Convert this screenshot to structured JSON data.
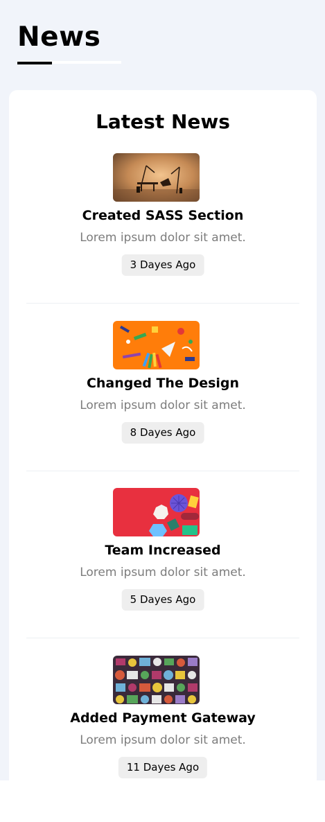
{
  "page": {
    "title": "News"
  },
  "latest_news": {
    "heading": "Latest News",
    "items": [
      {
        "title": "Created SASS Section",
        "description": "Lorem ipsum dolor sit amet.",
        "age": "3 Dayes Ago",
        "image": "desk-lamp-thumbnail"
      },
      {
        "title": "Changed The Design",
        "description": "Lorem ipsum dolor sit amet.",
        "age": "8 Dayes Ago",
        "image": "stationery-thumbnail"
      },
      {
        "title": "Team Increased",
        "description": "Lorem ipsum dolor sit amet.",
        "age": "5 Dayes Ago",
        "image": "shapes-thumbnail"
      },
      {
        "title": "Added Payment Gateway",
        "description": "Lorem ipsum dolor sit amet.",
        "age": "11 Dayes Ago",
        "image": "doodle-thumbnail"
      }
    ]
  },
  "colors": {
    "page_background": "#f1f4fa",
    "card_background": "#ffffff",
    "badge_background": "#eeeeee",
    "accent": "#000000",
    "muted_text": "#7c7c7c"
  }
}
